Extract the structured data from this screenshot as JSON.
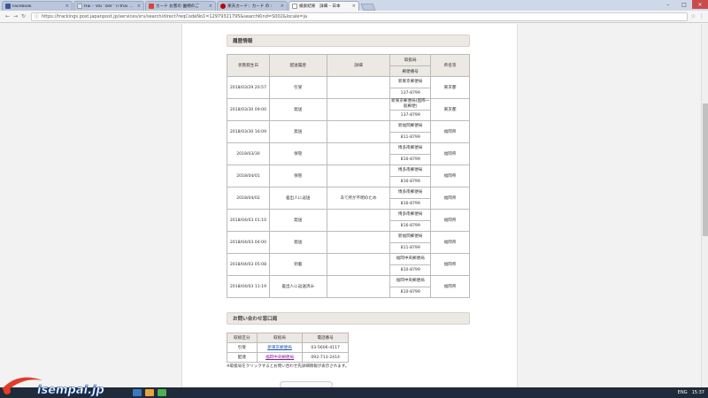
{
  "browser": {
    "tabs": [
      {
        "label": "Facebook",
        "color": "#3b5998",
        "active": false
      },
      {
        "label": "Hải – Vải ' bếr ' n thái Ru:",
        "color": "#e0e6f0",
        "active": false
      },
      {
        "label": "カード お客の 園柄のご",
        "color": "#d44638",
        "active": false
      },
      {
        "label": "楽天カード：カード の :",
        "color": "#bf0000",
        "active": false
      },
      {
        "label": "検索結果　詳細 – 日本",
        "color": "#ffffff",
        "active": true
      }
    ],
    "url": "https://trackings.post.japanpost.jp/services/srv/search/direct?reqCodeNo1=12979321795&searchKind=S002&locale=ja"
  },
  "history": {
    "title": "履歴情報",
    "headers": {
      "date": "状態発生日",
      "type": "配送履歴",
      "detail": "詳細",
      "office": "取扱局",
      "postcode": "郵便番号",
      "pref": "県名等"
    },
    "rows": [
      {
        "date": "2018/03/29 20:57",
        "type": "引受",
        "detail": "",
        "office": "新東京郵便局",
        "postcode": "137-8799",
        "pref": "東京都"
      },
      {
        "date": "2018/03/30 09:00",
        "type": "発送",
        "detail": "",
        "office": "新東京郵便局(国際一般郵便)",
        "postcode": "137-8799",
        "pref": "東京都"
      },
      {
        "date": "2018/03/30 16:09",
        "type": "発送",
        "detail": "",
        "office": "新福岡郵便局",
        "postcode": "811-8799",
        "pref": "福岡県"
      },
      {
        "date": "2018/03/30",
        "type": "保管",
        "detail": "",
        "office": "博多南郵便局",
        "postcode": "816-8799",
        "pref": "福岡県"
      },
      {
        "date": "2018/04/01",
        "type": "保管",
        "detail": "",
        "office": "博多南郵便局",
        "postcode": "816-8799",
        "pref": "福岡県"
      },
      {
        "date": "2018/04/02",
        "type": "差出人に返送",
        "detail": "あて所が不明のため",
        "office": "博多南郵便局",
        "postcode": "816-8799",
        "pref": "福岡県"
      },
      {
        "date": "2018/04/03 01:10",
        "type": "発送",
        "detail": "",
        "office": "博多南郵便局",
        "postcode": "816-8799",
        "pref": "福岡県"
      },
      {
        "date": "2018/04/03 04:00",
        "type": "発送",
        "detail": "",
        "office": "新福岡郵便局",
        "postcode": "811-8799",
        "pref": "福岡県"
      },
      {
        "date": "2018/04/03 05:08",
        "type": "到着",
        "detail": "",
        "office": "福岡中央郵便局",
        "postcode": "810-8799",
        "pref": "福岡県"
      },
      {
        "date": "2018/04/03 11:19",
        "type": "差出人に返送済み",
        "detail": "",
        "office": "福岡中央郵便局",
        "postcode": "810-8799",
        "pref": "福岡県"
      }
    ]
  },
  "contact": {
    "title": "お問い合わせ窓口局",
    "headers": {
      "type": "取扱区分",
      "office": "取扱局",
      "tel": "電話番号"
    },
    "rows": [
      {
        "type": "引受",
        "office": "新東京郵便局",
        "tel": "03-5606-4117"
      },
      {
        "type": "配達",
        "office": "福岡中央郵便局",
        "tel": "092-713-2414"
      }
    ],
    "note": "※取扱局をクリックするとお問い合わせ先詳細情報が表示されます。"
  },
  "taskbar": {
    "time": "15:37",
    "lang": "ENG"
  },
  "watermark": {
    "text": "isempai.jp"
  }
}
